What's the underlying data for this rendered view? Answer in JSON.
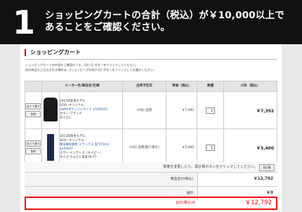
{
  "banner": {
    "step": "1",
    "line1": "ショッピングカートの合計（税込）が￥10,000以上で",
    "line2": "あることをご確認ください。"
  },
  "cart": {
    "title": "ショッピングカート",
    "intro1": "ショッピングカートの中身をご確認のうえ、【次へ】ボタンをクリックしてください。",
    "intro2": "他の商品もご注文される場合は、【ショッピングを続ける】ボタンをクリックしてお選びください。",
    "headers": [
      "",
      "メーカー名/商品名/仕様",
      "出荷予定日",
      "単価（税込）",
      "数量",
      "小計（税込）"
    ],
    "item_buttons": {
      "later": "あとで買う",
      "delete": "削除"
    },
    "items": [
      {
        "season": "2015年秋冬モデル",
        "brand": "GOO -オリジナル",
        "name": "2WAYダウンジャケット $1ADU03",
        "color": "カラー:ブラック",
        "size": "サイズ:L",
        "ship": "(5日) 出荷",
        "price": "￥7,392",
        "qty": "1",
        "subtotal": "￥7,392"
      },
      {
        "season": "2015年秋冬モデル",
        "brand": "GOO -オリジナル",
        "name": "暖深細身素材 スラックス 股下79cm $1AFA07",
        "color": "カラー:インディゴ（ネイビー）",
        "size": "サイズ:ウエスト目安79-77",
        "ship": "(5日) 出荷(取り寄せ)",
        "price": "￥5,400",
        "qty": "1",
        "subtotal": "￥5,400"
      }
    ],
    "recalc_note": "数量を変更したら、再計算ボタンをクリックしてください。",
    "recalc_button": "再計算",
    "product_total_label": "商品合計(税込)",
    "product_total": "￥12,792",
    "shipping_label": "送料",
    "shipping": "￥0",
    "grand_total_label": "合計(税込)※",
    "grand_total": "￥12,792"
  }
}
